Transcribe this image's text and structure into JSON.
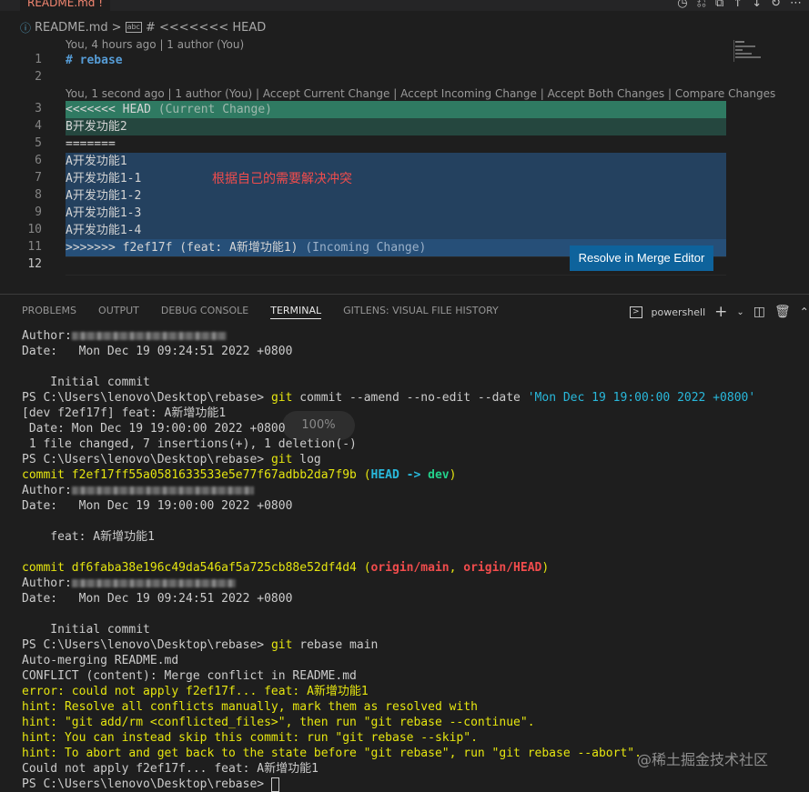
{
  "tab": {
    "label": "README.md",
    "dirty_mark": "!"
  },
  "breadcrumb": {
    "file": "README.md",
    "separator": ">",
    "symbol_icon": "markdown-heading-icon",
    "symbol": "# <<<<<<< HEAD"
  },
  "editor": {
    "codelens_top": "You, 4 hours ago | 1 author (You)",
    "codelens_conflict": "You, 1 second ago | 1 author (You) | Accept Current Change | Accept Incoming Change | Accept Both Changes | Compare Changes",
    "line_numbers": [
      "1",
      "2",
      "3",
      "4",
      "5",
      "6",
      "7",
      "8",
      "9",
      "10",
      "11",
      "12"
    ],
    "line1": "# rebase",
    "line3_marker": "<<<<<<< HEAD",
    "line3_hint": "(Current Change)",
    "line4": "B开发功能2",
    "line5": "=======",
    "line6": "A开发功能1",
    "line7": "A开发功能1-1",
    "line8": "A开发功能1-2",
    "line9": "A开发功能1-3",
    "line10": "A开发功能1-4",
    "line11_marker": ">>>>>>> f2ef17f (feat: A新增功能1)",
    "line11_hint": "(Incoming Change)",
    "annotation": "根据自己的需要解决冲突",
    "resolve_button": "Resolve in Merge Editor",
    "colors": {
      "current_bg": "#2f7a62",
      "current_body_bg": "#25473f",
      "incoming_bg": "#264f78",
      "incoming_body_bg": "#24415f"
    }
  },
  "panel": {
    "tabs": [
      "PROBLEMS",
      "OUTPUT",
      "DEBUG CONSOLE",
      "TERMINAL",
      "GITLENS: VISUAL FILE HISTORY"
    ],
    "active_tab": "TERMINAL",
    "shell": "powershell",
    "icons": [
      "terminal-icon",
      "add-icon",
      "chevron-down-icon",
      "split-icon",
      "trash-icon",
      "chevron-up-icon"
    ]
  },
  "terminal": {
    "author_label": "Author:",
    "date1": "Date:   Mon Dec 19 09:24:51 2022 +0800",
    "msg_initial": "    Initial commit",
    "prompt": "PS C:\\Users\\lenovo\\Desktop\\rebase>",
    "cmd_amend_git": "git",
    "cmd_amend_args": "commit --amend --no-edit --date",
    "cmd_amend_str": "'Mon Dec 19 19:00:00 2022 +0800'",
    "amend_out1": "[dev f2ef17f] feat: A新增功能1",
    "amend_out2": " Date: Mon Dec 19 19:00:00 2022 +0800",
    "amend_out3": " 1 file changed, 7 insertions(+), 1 deletion(-)",
    "cmd_log": "log",
    "commit1_hash": "commit f2ef17ff55a0581633533e5e77f67adbb2da7f9b",
    "commit1_head": "HEAD",
    "commit1_arrow": "->",
    "commit1_branch": "dev",
    "date2": "Date:   Mon Dec 19 19:00:00 2022 +0800",
    "msg_feat": "    feat: A新增功能1",
    "commit2_hash": "commit df6faba38e196c49da546af5a725cb88e52df4d4",
    "commit2_ref1": "origin/main",
    "commit2_ref2": "origin/HEAD",
    "date3": "Date:   Mon Dec 19 09:24:51 2022 +0800",
    "cmd_rebase": "rebase main",
    "out_automerge": "Auto-merging README.md",
    "out_conflict": "CONFLICT (content): Merge conflict in README.md",
    "out_error": "error: could not apply f2ef17f... feat: A新增功能1",
    "hint1": "hint: Resolve all conflicts manually, mark them as resolved with",
    "hint2": "hint: \"git add/rm <conflicted_files>\", then run \"git rebase --continue\".",
    "hint3": "hint: You can instead skip this commit: run \"git rebase --skip\".",
    "hint4": "hint: To abort and get back to the state before \"git rebase\", run \"git rebase --abort\".",
    "out_could_not": "Could not apply f2ef17f... feat: A新增功能1",
    "zoom": "100%"
  },
  "watermark": "@稀土掘金技术社区"
}
